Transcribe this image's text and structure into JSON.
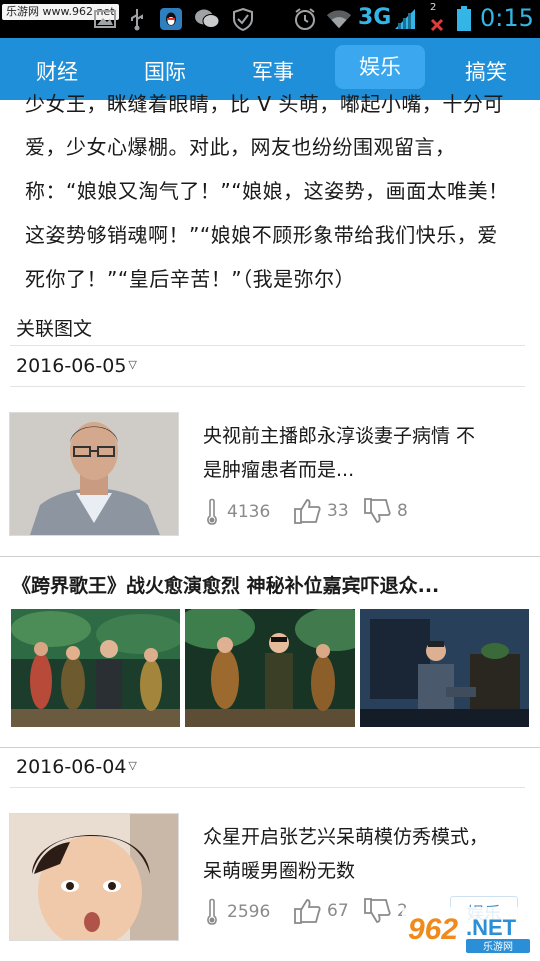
{
  "status_bar": {
    "site_label": "乐游网 www.962.net",
    "network": "3G",
    "notification_count": "2",
    "time": "0:15"
  },
  "tabs": [
    {
      "label": "财经",
      "active": false
    },
    {
      "label": "国际",
      "active": false
    },
    {
      "label": "军事",
      "active": false
    },
    {
      "label": "娱乐",
      "active": true
    },
    {
      "label": "搞笑",
      "active": false
    }
  ],
  "article": {
    "lines": [
      "少女王，眯缝着眼睛，比 V 头萌，嘟起小嘴，十分可",
      "爱，少女心爆棚。对此，网友也纷纷围观留言，",
      "称：“娘娘又淘气了！”“娘娘，这姿势，画面太唯美！",
      "这姿势够销魂啊！”“娘娘不顾形象带给我们快乐，爱",
      "死你了！”“皇后辛苦！”（我是弥尔）"
    ]
  },
  "related_label": "关联图文",
  "groups": [
    {
      "date": "2016-06-05",
      "caret": "▽",
      "item": {
        "title_line1": "央视前主播郎永淳谈妻子病情 不",
        "title_line2": "是肿瘤患者而是...",
        "views": "4136",
        "likes": "33",
        "dislikes": "8"
      },
      "gallery_title": "《跨界歌王》战火愈演愈烈 神秘补位嘉宾吓退众..."
    },
    {
      "date": "2016-06-04",
      "caret": "▽",
      "item": {
        "title_line1": "众星开启张艺兴呆萌模仿秀模式，",
        "title_line2": "呆萌暖男圈粉无数",
        "views": "2596",
        "likes": "67",
        "dislikes": "2",
        "tag": "娱乐"
      }
    }
  ],
  "watermark": {
    "brand": "962",
    "suffix": ".NET",
    "caption": "乐游网"
  },
  "colors": {
    "tab_bar": "#1e8fd8",
    "tab_active": "#3aa7ef",
    "status_accent": "#33b5e5"
  }
}
